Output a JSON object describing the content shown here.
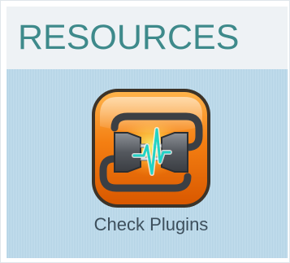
{
  "header": {
    "title": "RESOURCES",
    "title_color": "#3e8a8b"
  },
  "panel": {
    "background_color": "#bcd9ea"
  },
  "tiles": [
    {
      "label": "Check Plugins",
      "icon": "plugin-connector-icon",
      "icon_bg_color": "#f07c0c"
    }
  ]
}
